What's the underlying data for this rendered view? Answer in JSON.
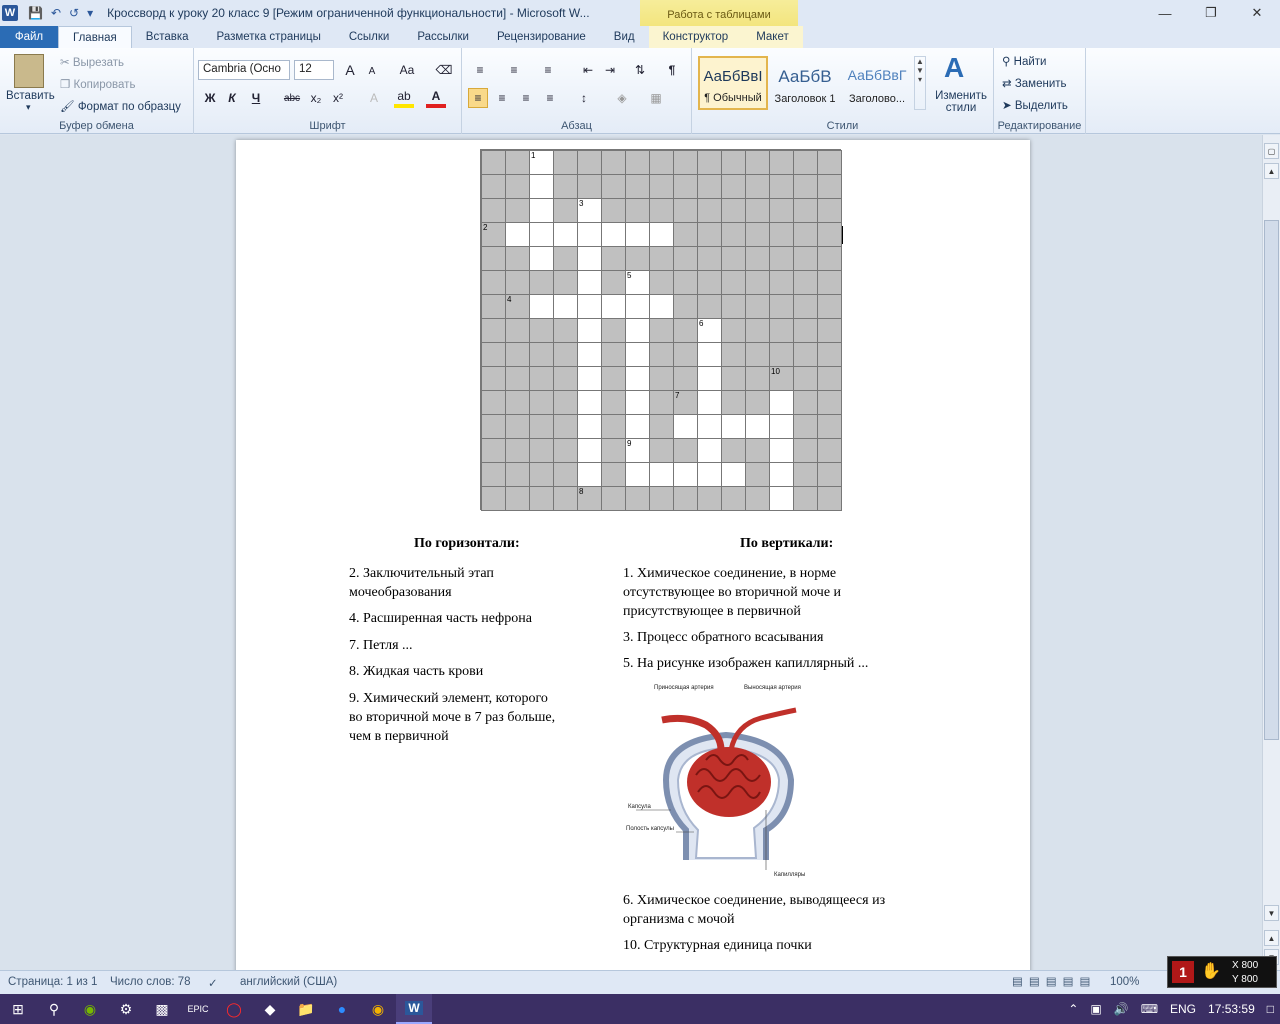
{
  "window": {
    "title": "Кроссворд к уроку 20 класс 9 [Режим ограниченной функциональности]  -  Microsoft W...",
    "context_tab": "Работа с таблицами",
    "app_letter": "W"
  },
  "tabs": [
    {
      "label": "Файл"
    },
    {
      "label": "Главная"
    },
    {
      "label": "Вставка"
    },
    {
      "label": "Разметка страницы"
    },
    {
      "label": "Ссылки"
    },
    {
      "label": "Рассылки"
    },
    {
      "label": "Рецензирование"
    },
    {
      "label": "Вид"
    },
    {
      "label": "Конструктор"
    },
    {
      "label": "Макет"
    }
  ],
  "ribbon": {
    "clipboard": {
      "paste": "Вставить",
      "cut": "Вырезать",
      "copy": "Копировать",
      "format_painter": "Формат по образцу",
      "label": "Буфер обмена"
    },
    "font": {
      "name": "Cambria (Осно",
      "size": "12",
      "label": "Шрифт",
      "bold": "Ж",
      "italic": "К",
      "underline": "Ч",
      "strike": "abc",
      "sub": "x₂",
      "sup": "x²",
      "grow": "A",
      "shrink": "A",
      "case": "Aa",
      "color_letter": "A"
    },
    "paragraph": {
      "label": "Абзац",
      "pilcrow": "¶"
    },
    "styles": {
      "label": "Стили",
      "items": [
        {
          "preview": "АаБбВвІ",
          "name": "¶ Обычный"
        },
        {
          "preview": "АаБбВ",
          "name": "Заголовок 1"
        },
        {
          "preview": "АаБбВвГ",
          "name": "Заголово..."
        }
      ],
      "change": "Изменить стили"
    },
    "editing": {
      "label": "Редактирование",
      "find": "Найти",
      "replace": "Заменить",
      "select": "Выделить"
    }
  },
  "crossword": {
    "open": [
      [
        0,
        2
      ],
      [
        1,
        2
      ],
      [
        2,
        2
      ],
      [
        2,
        4
      ],
      [
        3,
        1
      ],
      [
        3,
        2
      ],
      [
        3,
        3
      ],
      [
        3,
        4
      ],
      [
        3,
        5
      ],
      [
        3,
        6
      ],
      [
        3,
        7
      ],
      [
        4,
        2
      ],
      [
        4,
        4
      ],
      [
        5,
        4
      ],
      [
        5,
        6
      ],
      [
        6,
        2
      ],
      [
        6,
        3
      ],
      [
        6,
        4
      ],
      [
        6,
        5
      ],
      [
        6,
        6
      ],
      [
        6,
        7
      ],
      [
        7,
        4
      ],
      [
        7,
        6
      ],
      [
        7,
        9
      ],
      [
        8,
        4
      ],
      [
        8,
        6
      ],
      [
        8,
        9
      ],
      [
        9,
        4
      ],
      [
        9,
        6
      ],
      [
        9,
        9
      ],
      [
        10,
        4
      ],
      [
        10,
        6
      ],
      [
        10,
        9
      ],
      [
        10,
        12
      ],
      [
        11,
        4
      ],
      [
        11,
        6
      ],
      [
        11,
        8
      ],
      [
        11,
        9
      ],
      [
        11,
        10
      ],
      [
        11,
        11
      ],
      [
        11,
        12
      ],
      [
        12,
        4
      ],
      [
        12,
        6
      ],
      [
        12,
        9
      ],
      [
        12,
        12
      ],
      [
        13,
        4
      ],
      [
        13,
        6
      ],
      [
        13,
        7
      ],
      [
        13,
        8
      ],
      [
        13,
        9
      ],
      [
        13,
        10
      ],
      [
        13,
        12
      ],
      [
        14,
        12
      ],
      [
        15,
        4
      ],
      [
        15,
        5
      ],
      [
        15,
        6
      ],
      [
        15,
        7
      ],
      [
        15,
        8
      ],
      [
        15,
        9
      ],
      [
        15,
        12
      ]
    ],
    "numbers": [
      {
        "r": 0,
        "c": 2,
        "n": "1"
      },
      {
        "r": 2,
        "c": 4,
        "n": "3"
      },
      {
        "r": 3,
        "c": 0,
        "n": "2"
      },
      {
        "r": 5,
        "c": 6,
        "n": "5"
      },
      {
        "r": 6,
        "c": 1,
        "n": "4"
      },
      {
        "r": 7,
        "c": 9,
        "n": "6"
      },
      {
        "r": 9,
        "c": 12,
        "n": "10"
      },
      {
        "r": 10,
        "c": 8,
        "n": "7"
      },
      {
        "r": 12,
        "c": 6,
        "n": "9"
      },
      {
        "r": 14,
        "c": 4,
        "n": "8"
      }
    ]
  },
  "clues": {
    "across_title": "По горизонтали:",
    "down_title": "По вертикали:",
    "across": [
      [
        "2. Заключительный этап",
        "мочеобразования"
      ],
      [
        "4. Расширенная часть нефрона"
      ],
      [
        "7. Петля ..."
      ],
      [
        "8. Жидкая часть крови"
      ],
      [
        "9. Химический элемент, которого",
        "во вторичной моче в 7 раз больше,",
        "чем в первичной"
      ]
    ],
    "down": [
      [
        "1. Химическое соединение, в норме",
        "отсутствующее во вторичной моче и",
        "присутствующее  в первичной"
      ],
      [
        "3. Процесс обратного всасывания"
      ],
      [
        "5. На рисунке изображен капиллярный ..."
      ],
      [
        "6. Химическое соединение, выводящееся из",
        "организма с мочой"
      ],
      [
        "10. Структурная единица почки"
      ]
    ]
  },
  "figure": {
    "label_in": "Приносящая артерия",
    "label_out": "Выносящая артерия",
    "label_capsule": "Капсула",
    "label_cavity": "Полость капсулы",
    "label_caps": "Капилляры"
  },
  "status": {
    "page": "Страница: 1 из 1",
    "words": "Число слов: 78",
    "lang": "английский (США)",
    "zoom": "100%"
  },
  "overlay": {
    "x": "X 800",
    "y": "Y 800"
  },
  "taskbar": {
    "lang": "ENG",
    "time": "17:53:59"
  }
}
